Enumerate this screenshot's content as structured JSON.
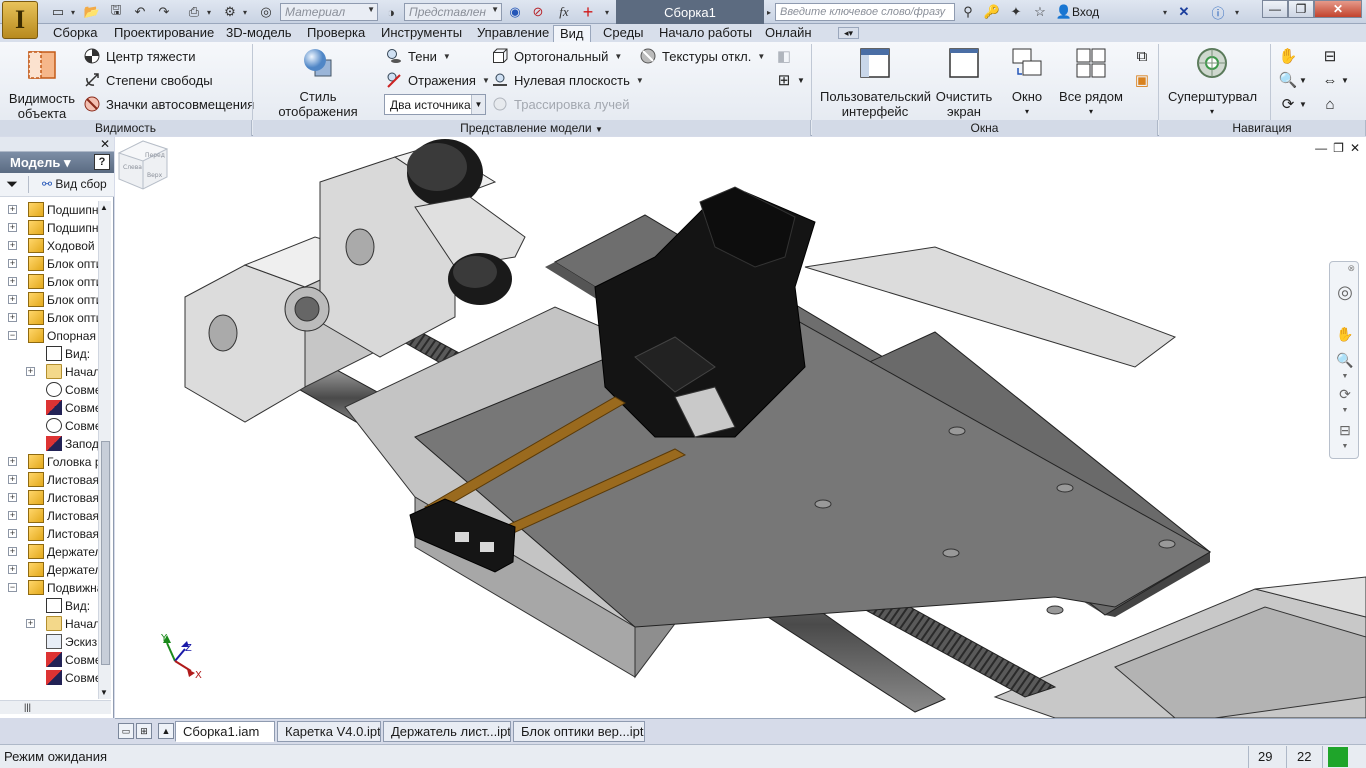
{
  "window": {
    "title": "Сборка1",
    "material_combo": "Материал",
    "representation_combo": "Представлен",
    "help_search_placeholder": "Введите ключевое слово/фразу",
    "sign_in": "Вход",
    "minimize": "—",
    "restore": "❐",
    "close": "✕"
  },
  "ribbon_tabs": [
    "Сборка",
    "Проектирование",
    "3D-модель",
    "Проверка",
    "Инструменты",
    "Управление",
    "Вид",
    "Среды",
    "Начало работы",
    "Онлайн"
  ],
  "active_tab": "Вид",
  "ribbon": {
    "visibility": {
      "title": "Видимость",
      "object_visibility": "Видимость объекта",
      "center_of_gravity": "Центр тяжести",
      "degrees_of_freedom": "Степени свободы",
      "auto_limit_icons": "Значки автосовмещения"
    },
    "appearance": {
      "title": "Представление модели",
      "display_style": "Стиль отображения",
      "shadows": "Тени",
      "reflections": "Отражения",
      "lighting": "Два источника",
      "orthographic": "Ортогональный",
      "ground_plane": "Нулевая плоскость",
      "ray_tracing": "Трассировка лучей",
      "textures": "Текстуры откл."
    },
    "windows": {
      "title": "Окна",
      "user_interface": "Пользовательский интерфейс",
      "clean_screen": "Очистить экран",
      "window": "Окно",
      "tile": "Все рядом"
    },
    "navigate": {
      "title": "Навигация",
      "steering_wheels": "Суперштурвал"
    }
  },
  "browser": {
    "title": "Модель",
    "filter_label": "Вид сбор",
    "help": "?",
    "tree": [
      {
        "label": "Подшипни",
        "indent": 0,
        "icon": "assembly",
        "expand": "+"
      },
      {
        "label": "Подшипни",
        "indent": 0,
        "icon": "assembly",
        "expand": "+"
      },
      {
        "label": "Ходовой в",
        "indent": 0,
        "icon": "assembly",
        "expand": "+"
      },
      {
        "label": "Блок опти",
        "indent": 0,
        "icon": "assembly",
        "expand": "+"
      },
      {
        "label": "Блок опти",
        "indent": 0,
        "icon": "assembly",
        "expand": "+"
      },
      {
        "label": "Блок опти",
        "indent": 0,
        "icon": "assembly",
        "expand": "+"
      },
      {
        "label": "Блок опти",
        "indent": 0,
        "icon": "assembly",
        "expand": "+"
      },
      {
        "label": "Опорная",
        "indent": 0,
        "icon": "assembly",
        "expand": "−"
      },
      {
        "label": "Вид:",
        "indent": 1,
        "icon": "view",
        "expand": ""
      },
      {
        "label": "Начал",
        "indent": 1,
        "icon": "folder",
        "expand": "+"
      },
      {
        "label": "Совме",
        "indent": 1,
        "icon": "constraint-a",
        "expand": ""
      },
      {
        "label": "Совме",
        "indent": 1,
        "icon": "constraint-b",
        "expand": ""
      },
      {
        "label": "Совме",
        "indent": 1,
        "icon": "constraint-a",
        "expand": ""
      },
      {
        "label": "Запод",
        "indent": 1,
        "icon": "constraint-b",
        "expand": ""
      },
      {
        "label": "Головка р",
        "indent": 0,
        "icon": "assembly",
        "expand": "+"
      },
      {
        "label": "Листовая",
        "indent": 0,
        "icon": "assembly",
        "expand": "+"
      },
      {
        "label": "Листовая",
        "indent": 0,
        "icon": "assembly",
        "expand": "+"
      },
      {
        "label": "Листовая",
        "indent": 0,
        "icon": "assembly",
        "expand": "+"
      },
      {
        "label": "Листовая",
        "indent": 0,
        "icon": "assembly",
        "expand": "+"
      },
      {
        "label": "Держател",
        "indent": 0,
        "icon": "assembly",
        "expand": "+"
      },
      {
        "label": "Держател",
        "indent": 0,
        "icon": "assembly",
        "expand": "+"
      },
      {
        "label": "Подвижна",
        "indent": 0,
        "icon": "assembly",
        "expand": "−"
      },
      {
        "label": "Вид:",
        "indent": 1,
        "icon": "view",
        "expand": ""
      },
      {
        "label": "Начал",
        "indent": 1,
        "icon": "folder",
        "expand": "+"
      },
      {
        "label": "Эскиз",
        "indent": 1,
        "icon": "sketch",
        "expand": ""
      },
      {
        "label": "Совме",
        "indent": 1,
        "icon": "constraint-b",
        "expand": ""
      },
      {
        "label": "Совме",
        "indent": 1,
        "icon": "constraint-b",
        "expand": ""
      }
    ]
  },
  "viewport": {
    "triad": {
      "x": "X",
      "y": "Y",
      "z": "Z"
    },
    "viewcube": {
      "top": "Верх",
      "front": "Перед",
      "left": "Слева"
    }
  },
  "document_tabs": [
    "Сборка1.iam",
    "Каретка V4.0.ipt",
    "Держатель лист...ipt",
    "Блок оптики вер...ipt"
  ],
  "active_document": "Сборка1.iam",
  "status": {
    "message": "Режим ожидания",
    "count_1": "29",
    "count_2": "22"
  },
  "colors": {
    "ribbon_bg": "#eef1f6",
    "browser_header": "#6a7b93",
    "model_gray": "#b9b9b9",
    "model_black": "#141414",
    "belt_brown": "#9a6a1e",
    "status_ok": "#1fa52a"
  }
}
